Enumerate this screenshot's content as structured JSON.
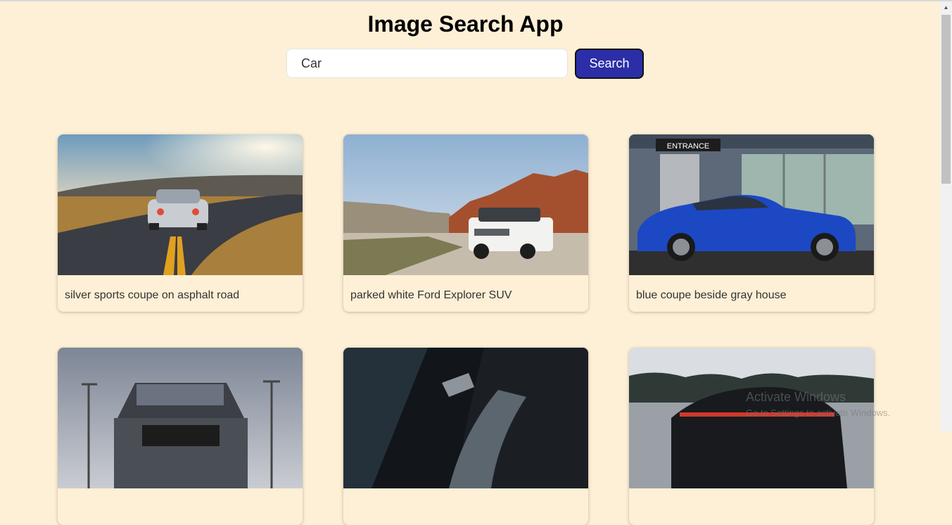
{
  "app": {
    "title": "Image Search App"
  },
  "search": {
    "value": "Car",
    "button_label": "Search"
  },
  "results": [
    {
      "caption": "silver sports coupe on asphalt road"
    },
    {
      "caption": "parked white Ford Explorer SUV"
    },
    {
      "caption": "blue coupe beside gray house"
    },
    {
      "caption": ""
    },
    {
      "caption": ""
    },
    {
      "caption": ""
    }
  ],
  "photo_text": {
    "entrance_sign": "ENTRANCE"
  },
  "watermark": {
    "line1": "Activate Windows",
    "line2": "Go to Settings to activate Windows."
  },
  "colors": {
    "background": "#fef0d6",
    "button": "#2c2ea8",
    "car_blue": "#1c48c4"
  }
}
